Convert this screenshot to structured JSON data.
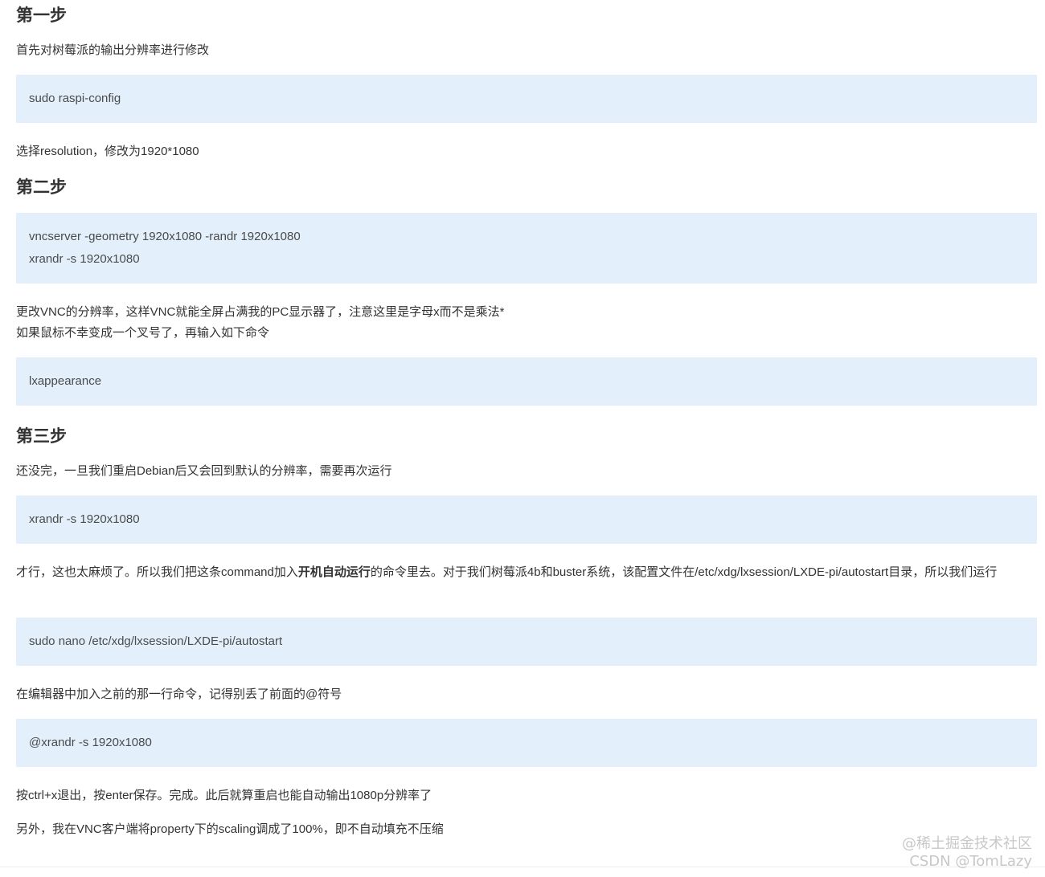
{
  "steps": [
    {
      "heading": "第一步",
      "intro": "首先对树莓派的输出分辨率进行修改",
      "code": [
        "sudo raspi-config"
      ],
      "after": "选择resolution，修改为1920*1080"
    },
    {
      "heading": "第二步",
      "code": [
        "vncserver -geometry 1920x1080 -randr 1920x1080",
        "xrandr -s 1920x1080"
      ],
      "after_line1": "更改VNC的分辨率，这样VNC就能全屏占满我的PC显示器了，注意这里是字母x而不是乘法*",
      "after_line2": "如果鼠标不幸变成一个叉号了，再输入如下命令",
      "code2": [
        "lxappearance"
      ]
    },
    {
      "heading": "第三步",
      "intro": "还没完，一旦我们重启Debian后又会回到默认的分辨率，需要再次运行",
      "code": [
        "xrandr -s 1920x1080"
      ],
      "autostart_text_before": "才行，这也太麻烦了。所以我们把这条command加入",
      "autostart_text_bold": "开机自动运行",
      "autostart_text_after": "的命令里去。对于我们树莓派4b和buster系统，该配置文件在/etc/xdg/lxsession/LXDE-pi/autostart目录，所以我们运行",
      "code2": [
        "sudo nano /etc/xdg/lxsession/LXDE-pi/autostart"
      ],
      "editor_text": "在编辑器中加入之前的那一行命令，记得别丢了前面的@符号",
      "code3": [
        "@xrandr -s 1920x1080"
      ],
      "save_text": "按ctrl+x退出，按enter保存。完成。此后就算重启也能自动输出1080p分辨率了",
      "scaling_text": "另外，我在VNC客户端将property下的scaling调成了100%，即不自动填充不压缩"
    }
  ],
  "watermark": {
    "line1": "@稀土掘金技术社区",
    "line2": "CSDN @TomLazy"
  }
}
